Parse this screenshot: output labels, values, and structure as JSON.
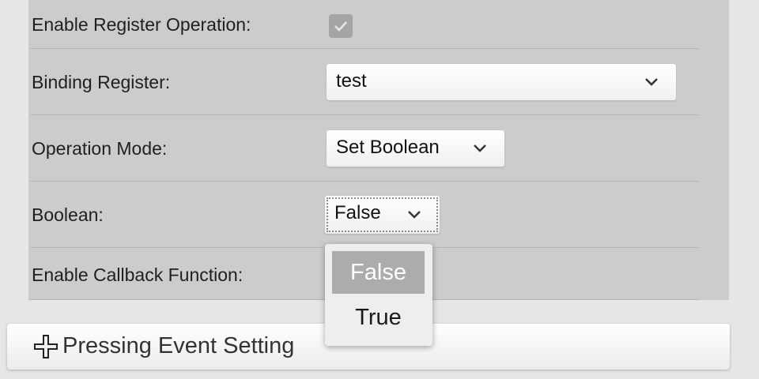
{
  "form": {
    "enable_register_label": "Enable Register Operation:",
    "enable_register_checked": true,
    "binding_register_label": "Binding Register:",
    "binding_register_value": "test",
    "operation_mode_label": "Operation Mode:",
    "operation_mode_value": "Set Boolean",
    "boolean_label": "Boolean:",
    "boolean_value": "False",
    "enable_callback_label": "Enable Callback Function:"
  },
  "boolean_dropdown": {
    "options": [
      "False",
      "True"
    ],
    "selected": "False"
  },
  "accordion": {
    "pressing_event_label": "Pressing Event Setting",
    "icon": "plus-icon"
  },
  "colors": {
    "panel_bg": "#cccccc",
    "page_bg": "#e6e6e6",
    "selected_option_bg": "#acacac",
    "checkbox_bg": "#a5a5a5"
  }
}
